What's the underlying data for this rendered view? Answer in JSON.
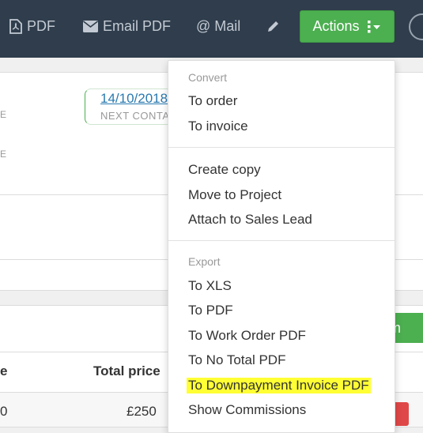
{
  "toolbar": {
    "pdf_label": "PDF",
    "email_pdf_label": "Email PDF",
    "mail_label": "@ Mail",
    "actions_label": "Actions"
  },
  "content": {
    "date_value": "14/10/2018",
    "date_label": "NEXT CONTA",
    "cut_label_1": "E",
    "cut_label_2": "E",
    "green_button_label": "em",
    "table": {
      "header_left": "e",
      "header_total": "Total price",
      "row_left": "0",
      "row_total": "£250"
    }
  },
  "dropdown": {
    "convert_header": "Convert",
    "to_order": "To order",
    "to_invoice": "To invoice",
    "create_copy": "Create copy",
    "move_to_project": "Move to Project",
    "attach_to_sales_lead": "Attach to Sales Lead",
    "export_header": "Export",
    "to_xls": "To XLS",
    "to_pdf": "To PDF",
    "to_work_order_pdf": "To Work Order PDF",
    "to_no_total_pdf": "To No Total PDF",
    "to_downpayment_invoice_pdf": "To Downpayment Invoice PDF",
    "show_commissions": "Show Commissions"
  },
  "colors": {
    "toolbar_bg": "#2f3d4c",
    "actions_green": "#4caf50",
    "highlight": "#ffff33",
    "link_blue": "#2a7ab0"
  }
}
